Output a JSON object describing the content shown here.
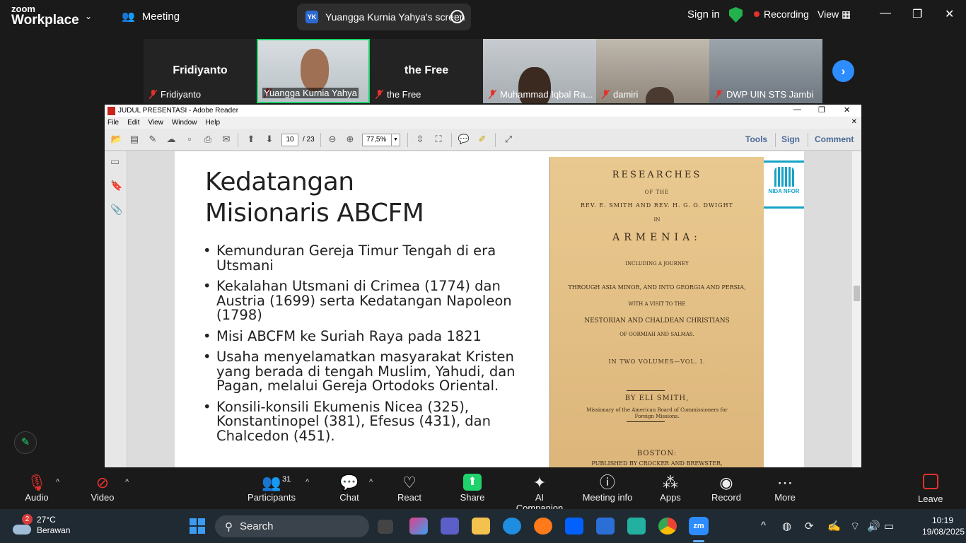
{
  "zoom": {
    "logo_top": "zoom",
    "logo_bottom": "Workplace",
    "meeting_label": "Meeting",
    "screen_tab": "Yuangga Kurnia Yahya's screen",
    "screen_tab_badge": "YK",
    "sign_in": "Sign in",
    "recording": "Recording",
    "view": "View",
    "participants": [
      {
        "name": "Fridiyanto",
        "big_name": "Fridiyanto",
        "video": false,
        "active": false
      },
      {
        "name": "Yuangga Kurnia Yahya",
        "big_name": "",
        "video": true,
        "active": true
      },
      {
        "name": "the Free",
        "big_name": "the Free",
        "video": false,
        "active": false
      },
      {
        "name": "Muhammad Iqbal Ra...",
        "big_name": "",
        "video": true,
        "active": false
      },
      {
        "name": "damiri",
        "big_name": "",
        "video": true,
        "active": false
      },
      {
        "name": "DWP UIN STS Jambi",
        "big_name": "",
        "video": true,
        "active": false
      }
    ]
  },
  "reader": {
    "title": "JUDUL PRESENTASI - Adobe Reader",
    "menu": [
      "File",
      "Edit",
      "View",
      "Window",
      "Help"
    ],
    "page_current": "10",
    "page_total": "/ 23",
    "zoom_value": "77,5%",
    "tools": "Tools",
    "sign": "Sign",
    "comment": "Comment"
  },
  "slide": {
    "title_line1": "Kedatangan",
    "title_line2": "Misionaris ABCFM",
    "bullets": [
      "Kemunduran Gereja Timur Tengah di era Utsmani",
      "Kekalahan Utsmani di Crimea (1774) dan Austria (1699) serta Kedatangan Napoleon (1798)",
      "Misi ABCFM ke Suriah Raya pada 1821",
      "Usaha menyelamatkan masyarakat Kristen yang berada di tengah Muslim, Yahudi, dan Pagan, melalui Gereja Ortodoks Oriental.",
      "Konsili-konsili Ekumenis Nicea (325), Konstantinopel (381), Efesus (431), dan Chalcedon (451)."
    ],
    "cover": {
      "l1": "RESEARCHES",
      "l2": "OF THE",
      "l3": "REV. E. SMITH AND REV. H. G. O. DWIGHT",
      "l4": "IN",
      "l5": "ARMENIA:",
      "l6": "INCLUDING A JOURNEY",
      "l7": "THROUGH ASIA MINOR, AND INTO GEORGIA AND PERSIA,",
      "l8": "WITH A VISIT TO THE",
      "l9": "NESTORIAN AND CHALDEAN CHRISTIANS",
      "l10": "OF OORMIAH AND SALMAS.",
      "l11": "IN TWO VOLUMES—VOL. I.",
      "l12": "BY ELI SMITH,",
      "l13": "Missionary of the American Board of Commissioners for Foreign Missions.",
      "l14": "BOSTON:",
      "l15": "PUBLISHED BY CROCKER AND BREWSTER,"
    },
    "brand_text": "NIDA NFOR"
  },
  "controls": {
    "audio": "Audio",
    "video": "Video",
    "participants": "Participants",
    "participants_count": "31",
    "chat": "Chat",
    "react": "React",
    "share": "Share",
    "ai": "AI Companion",
    "meeting_info": "Meeting info",
    "apps": "Apps",
    "record": "Record",
    "more": "More",
    "leave": "Leave"
  },
  "taskbar": {
    "weather_badge": "2",
    "temperature": "27°C",
    "condition": "Berawan",
    "search": "Search",
    "time": "10:19",
    "date": "19/08/2025",
    "zm": "zm"
  },
  "colors": {
    "zoom_green": "#1fd36c",
    "zoom_blue": "#2d8cff",
    "recording_red": "#e5312c",
    "book_cover": "#e2c084",
    "brand_cyan": "#16a3c7"
  }
}
